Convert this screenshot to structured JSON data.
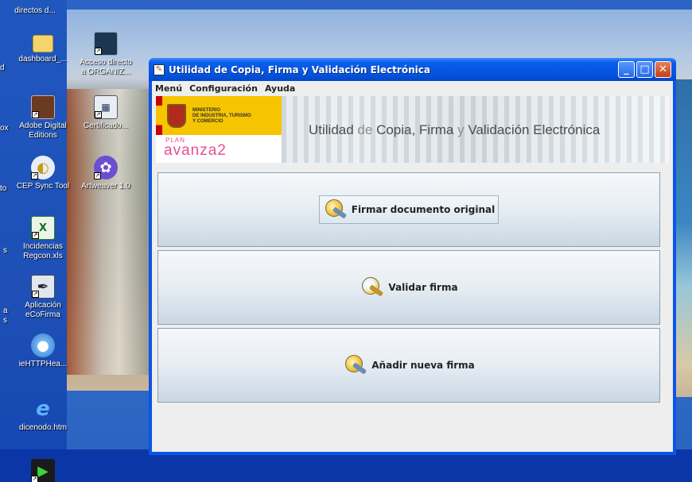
{
  "desktop": {
    "icons": [
      {
        "label": "directos d...",
        "icon": "shortcut-icon"
      },
      {
        "label": "dashboard_...",
        "icon": "folder-icon"
      },
      {
        "label": "Acceso directo a ORGANIZ...",
        "icon": "book-icon"
      },
      {
        "label": "Adobe Digital Editions",
        "icon": "book-icon"
      },
      {
        "label": "Certificado...",
        "icon": "certificate-icon"
      },
      {
        "label": "CEP Sync Tool",
        "icon": "sync-icon"
      },
      {
        "label": "Artweaver 1.0",
        "icon": "paint-icon"
      },
      {
        "label": "Incidencias Regcon.xls",
        "icon": "excel-icon"
      },
      {
        "label": "Aplicación eCoFirma",
        "icon": "pen-icon"
      },
      {
        "label": "ieHTTPHea...",
        "icon": "globe-icon"
      },
      {
        "label": "dicenodo.htm",
        "icon": "ie-icon"
      }
    ],
    "partial_labels": [
      "d",
      "ox",
      "to",
      "a",
      "s",
      "s"
    ]
  },
  "window": {
    "title": "Utilidad de Copia, Firma y Validación Electrónica",
    "minimize": "_",
    "maximize": "□",
    "close": "✕",
    "menu": [
      "Menú",
      "Configuración",
      "Ayuda"
    ],
    "banner": {
      "ministry_text": "MINISTERIO\nDE INDUSTRIA, TURISMO\nY COMERCIO",
      "plan": "PLAN",
      "avanza": "avanza2",
      "title_parts": [
        "Utilidad",
        " de ",
        "Copia, Firma",
        " y ",
        "Validación Electrónica"
      ]
    },
    "actions": [
      {
        "label": "Firmar documento original",
        "icon": "sign-document-icon"
      },
      {
        "label": "Validar firma",
        "icon": "validate-signature-icon"
      },
      {
        "label": "Añadir nueva firma",
        "icon": "add-signature-icon"
      }
    ]
  },
  "colors": {
    "titlebar": "#0454e0",
    "window_bg": "#eeeeee",
    "banner_ministry": "#f6c400",
    "avanza_pink": "#e6508e"
  }
}
